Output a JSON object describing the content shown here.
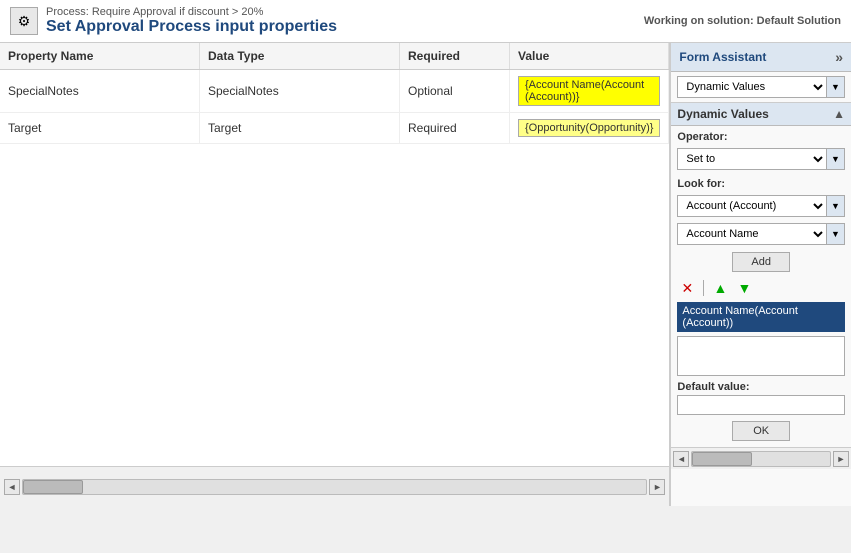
{
  "topbar": {
    "subtitle": "Process: Require Approval if discount > 20%",
    "title": "Set Approval Process input properties",
    "solution": "Working on solution: Default Solution",
    "icon": "⚙"
  },
  "table": {
    "columns": [
      "Property Name",
      "Data Type",
      "Required",
      "Value"
    ],
    "rows": [
      {
        "propertyName": "SpecialNotes",
        "dataType": "SpecialNotes",
        "required": "Optional",
        "value": "{Account Name(Account (Account))}"
      },
      {
        "propertyName": "Target",
        "dataType": "Target",
        "required": "Required",
        "value": "{Opportunity(Opportunity)}"
      }
    ]
  },
  "formAssistant": {
    "title": "Form Assistant",
    "arrowLabel": "»",
    "dynamicValuesLabel": "Dynamic Values",
    "dynamicValuesSectionLabel": "Dynamic Values",
    "collapseArrow": "▲",
    "operatorLabel": "Operator:",
    "operatorValue": "Set to",
    "lookForLabel": "Look for:",
    "lookForValue": "Account (Account)",
    "fieldValue": "Account Name",
    "addButtonLabel": "Add",
    "selectedItem": "Account Name(Account (Account))",
    "defaultValueLabel": "Default value:",
    "okButtonLabel": "OK"
  },
  "scrollbar": {
    "leftArrow": "◄",
    "rightArrow": "►"
  }
}
